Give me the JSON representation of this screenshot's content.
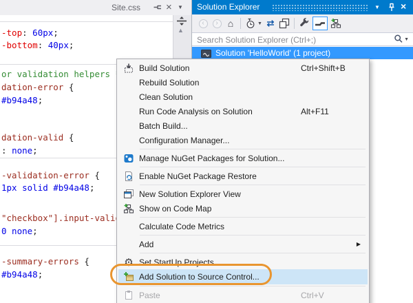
{
  "editor": {
    "tab_title": "Site.css",
    "lines": [
      {
        "s": [
          {
            "t": "-top"
          },
          {
            "t": ": "
          },
          {
            "t": "60px"
          },
          {
            "t": ";"
          }
        ]
      },
      {
        "s": [
          {
            "t": "-bottom"
          },
          {
            "t": ": "
          },
          {
            "t": "40px"
          },
          {
            "t": ";"
          }
        ]
      },
      {
        "s": [
          {
            "t": "or validation helpers */"
          }
        ]
      },
      {
        "s": [
          {
            "t": "dation-error "
          },
          {
            "t": "{"
          }
        ]
      },
      {
        "s": [
          {
            "t": "#b94a48"
          },
          {
            "t": ";"
          }
        ]
      },
      {
        "s": [
          {
            "t": "dation-valid "
          },
          {
            "t": "{"
          }
        ]
      },
      {
        "s": [
          {
            "t": ": "
          },
          {
            "t": "none"
          },
          {
            "t": ";"
          }
        ]
      },
      {
        "s": [
          {
            "t": "-validation-error "
          },
          {
            "t": "{"
          }
        ]
      },
      {
        "s": [
          {
            "t": "1px solid #b94a48"
          },
          {
            "t": ";"
          }
        ]
      },
      {
        "s": [
          {
            "t": "\"checkbox\"].input-valida"
          }
        ]
      },
      {
        "s": [
          {
            "t": "0 none"
          },
          {
            "t": ";"
          }
        ]
      },
      {
        "s": [
          {
            "t": "-summary-errors "
          },
          {
            "t": "{"
          }
        ]
      },
      {
        "s": [
          {
            "t": "#b94a48"
          },
          {
            "t": ";"
          }
        ]
      }
    ]
  },
  "solution_explorer": {
    "title": "Solution Explorer",
    "search_placeholder": "Search Solution Explorer (Ctrl+;)",
    "tree_root_label": "Solution 'HelloWorld' (1 project)"
  },
  "context_menu": {
    "items": [
      {
        "label": "Build Solution",
        "shortcut": "Ctrl+Shift+B"
      },
      {
        "label": "Rebuild Solution",
        "shortcut": ""
      },
      {
        "label": "Clean Solution",
        "shortcut": ""
      },
      {
        "label": "Run Code Analysis on Solution",
        "shortcut": "Alt+F11"
      },
      {
        "label": "Batch Build...",
        "shortcut": ""
      },
      {
        "label": "Configuration Manager...",
        "shortcut": ""
      },
      {
        "label": "Manage NuGet Packages for Solution...",
        "shortcut": ""
      },
      {
        "label": "Enable NuGet Package Restore",
        "shortcut": ""
      },
      {
        "label": "New Solution Explorer View",
        "shortcut": ""
      },
      {
        "label": "Show on Code Map",
        "shortcut": ""
      },
      {
        "label": "Calculate Code Metrics",
        "shortcut": ""
      },
      {
        "label": "Add",
        "shortcut": ""
      },
      {
        "label": "Set StartUp Projects...",
        "shortcut": ""
      },
      {
        "label": "Add Solution to Source Control...",
        "shortcut": ""
      },
      {
        "label": "Paste",
        "shortcut": "Ctrl+V"
      }
    ]
  },
  "annotation": {
    "shape": "ellipse-highlight",
    "target": "Add Solution to Source Control...",
    "color": "#E9952F"
  },
  "colors": {
    "titlebar_blue": "#007ACC",
    "selection_blue": "#3399FF",
    "menu_highlight": "#CDE5F7",
    "css_property_red": "#E00000",
    "css_value_blue": "#0000E6",
    "css_selector_maroon": "#9B2D20",
    "css_comment_green": "#348C34"
  },
  "icons": {
    "tab_close": "×",
    "dropdown_arrow": "▼",
    "scroll_up": "▲",
    "submenu_arrow": "▶",
    "home": "⌂",
    "refresh": "⇄",
    "gear": "⚙",
    "back": "‹",
    "forward": "›"
  }
}
